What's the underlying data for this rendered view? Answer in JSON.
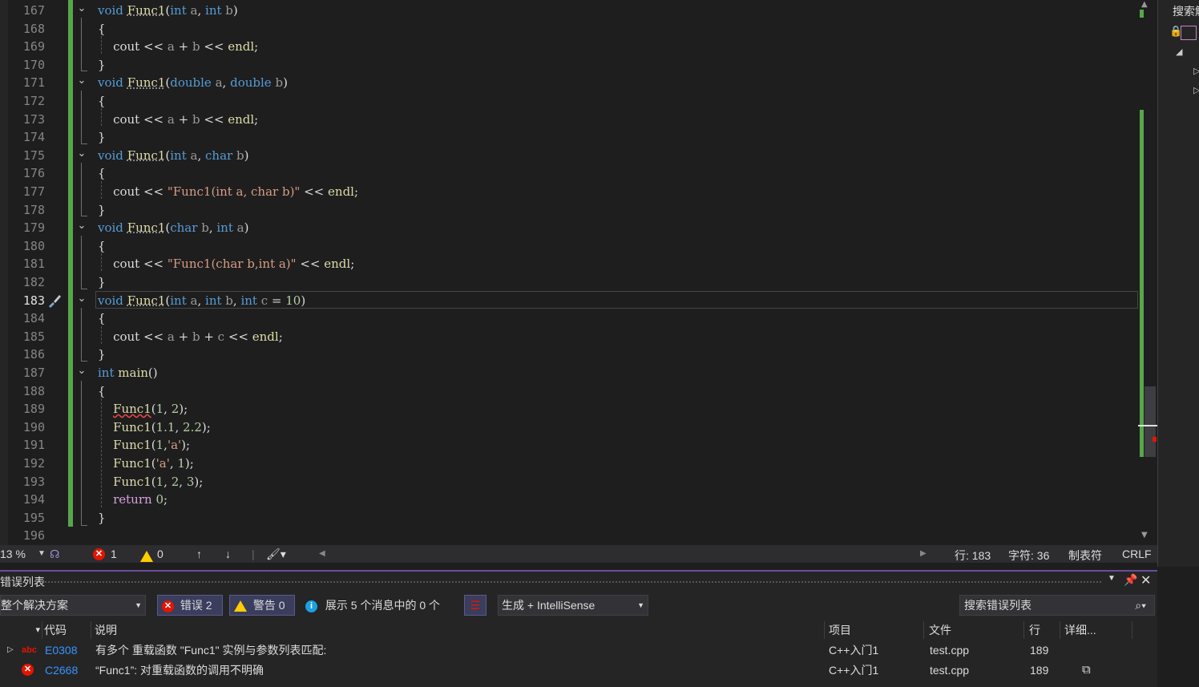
{
  "editor": {
    "lines": [
      {
        "n": "167",
        "html": "<span class='kw'>void</span> <span class='fn dot'>Func1</span>(<span class='kw'>int</span> <span class='pm'>a</span>, <span class='kw'>int</span> <span class='pm'>b</span>)"
      },
      {
        "n": "168",
        "html": "{"
      },
      {
        "n": "169",
        "html": "    cout &lt;&lt; <span class='pm'>a</span> + <span class='pm'>b</span> &lt;&lt; <span class='fn'>endl</span>;"
      },
      {
        "n": "170",
        "html": "}"
      },
      {
        "n": "171",
        "html": "<span class='kw'>void</span> <span class='fn dot'>Func1</span>(<span class='kw'>double</span> <span class='pm'>a</span>, <span class='kw'>double</span> <span class='pm'>b</span>)"
      },
      {
        "n": "172",
        "html": "{"
      },
      {
        "n": "173",
        "html": "    cout &lt;&lt; <span class='pm'>a</span> + <span class='pm'>b</span> &lt;&lt; <span class='fn'>endl</span>;"
      },
      {
        "n": "174",
        "html": "}"
      },
      {
        "n": "175",
        "html": "<span class='kw'>void</span> <span class='fn dot'>Func1</span>(<span class='kw'>int</span> <span class='pm'>a</span>, <span class='kw'>char</span> <span class='pm'>b</span>)"
      },
      {
        "n": "176",
        "html": "{"
      },
      {
        "n": "177",
        "html": "    cout &lt;&lt; <span class='str'>\"Func1(int a, char b)\"</span> &lt;&lt; <span class='fn'>endl</span>;"
      },
      {
        "n": "178",
        "html": "}"
      },
      {
        "n": "179",
        "html": "<span class='kw'>void</span> <span class='fn dot'>Func1</span>(<span class='kw'>char</span> <span class='pm'>b</span>, <span class='kw'>int</span> <span class='pm'>a</span>)"
      },
      {
        "n": "180",
        "html": "{"
      },
      {
        "n": "181",
        "html": "    cout &lt;&lt; <span class='str'>\"Func1(char b,int a)\"</span> &lt;&lt; <span class='fn'>endl</span>;"
      },
      {
        "n": "182",
        "html": "}"
      },
      {
        "n": "183",
        "html": "<span class='kw'>void</span> <span class='fn dot'>Func1</span>(<span class='kw'>int</span> <span class='pm'>a</span>, <span class='kw'>int</span> <span class='pm'>b</span>, <span class='kw'>int</span> <span class='pm'>c</span> = <span class='num'>10</span>)"
      },
      {
        "n": "184",
        "html": "{"
      },
      {
        "n": "185",
        "html": "    cout &lt;&lt; <span class='pm'>a</span> + <span class='pm'>b</span> + <span class='pm'>c</span> &lt;&lt; <span class='fn'>endl</span>;"
      },
      {
        "n": "186",
        "html": "}"
      },
      {
        "n": "187",
        "html": "<span class='kw'>int</span> <span class='fn'>main</span>()"
      },
      {
        "n": "188",
        "html": "{"
      },
      {
        "n": "189",
        "html": "    <span class='fn squig'>Func1</span>(<span class='num'>1</span>, <span class='num'>2</span>);"
      },
      {
        "n": "190",
        "html": "    <span class='fn'>Func1</span>(<span class='num'>1.1</span>, <span class='num'>2.2</span>);"
      },
      {
        "n": "191",
        "html": "    <span class='fn'>Func1</span>(<span class='num'>1</span>,<span class='str'>'a'</span>);"
      },
      {
        "n": "192",
        "html": "    <span class='fn'>Func1</span>(<span class='str'>'a'</span>, <span class='num'>1</span>);"
      },
      {
        "n": "193",
        "html": "    <span class='fn'>Func1</span>(<span class='num'>1</span>, <span class='num'>2</span>, <span class='num'>3</span>);"
      },
      {
        "n": "194",
        "html": "    <span class='ctl'>return</span> <span class='num'>0</span>;"
      },
      {
        "n": "195",
        "html": "}"
      },
      {
        "n": "196",
        "html": ""
      }
    ],
    "current_line": "183"
  },
  "statusbar": {
    "zoom": "13 %",
    "errors": "1",
    "warnings": "0",
    "line": "行: 183",
    "char": "字符: 36",
    "indent": "制表符",
    "eol": "CRLF"
  },
  "right_panel": {
    "search_label": "搜索解"
  },
  "error_list": {
    "title": "错误列表",
    "scope": "整个解决方案",
    "errors_btn": "错误 2",
    "warnings_btn": "警告 0",
    "messages_btn": "展示 5 个消息中的 0 个",
    "build_filter": "生成 + IntelliSense",
    "search_placeholder": "搜索错误列表",
    "columns": {
      "code": "代码",
      "desc": "说明",
      "project": "项目",
      "file": "文件",
      "line": "行",
      "detail": "详细..."
    },
    "rows": [
      {
        "code": "E0308",
        "desc": "有多个 重载函数 \"Func1\" 实例与参数列表匹配:",
        "project": "C++入门1",
        "file": "test.cpp",
        "line": "189"
      },
      {
        "code": "C2668",
        "desc": "“Func1”: 对重载函数的调用不明确",
        "project": "C++入门1",
        "file": "test.cpp",
        "line": "189"
      }
    ]
  },
  "colors": {
    "accent": "#6a4c9c",
    "green": "#57a64a",
    "error": "#e51400",
    "warning": "#ffcc00",
    "keyword": "#569cd6"
  }
}
